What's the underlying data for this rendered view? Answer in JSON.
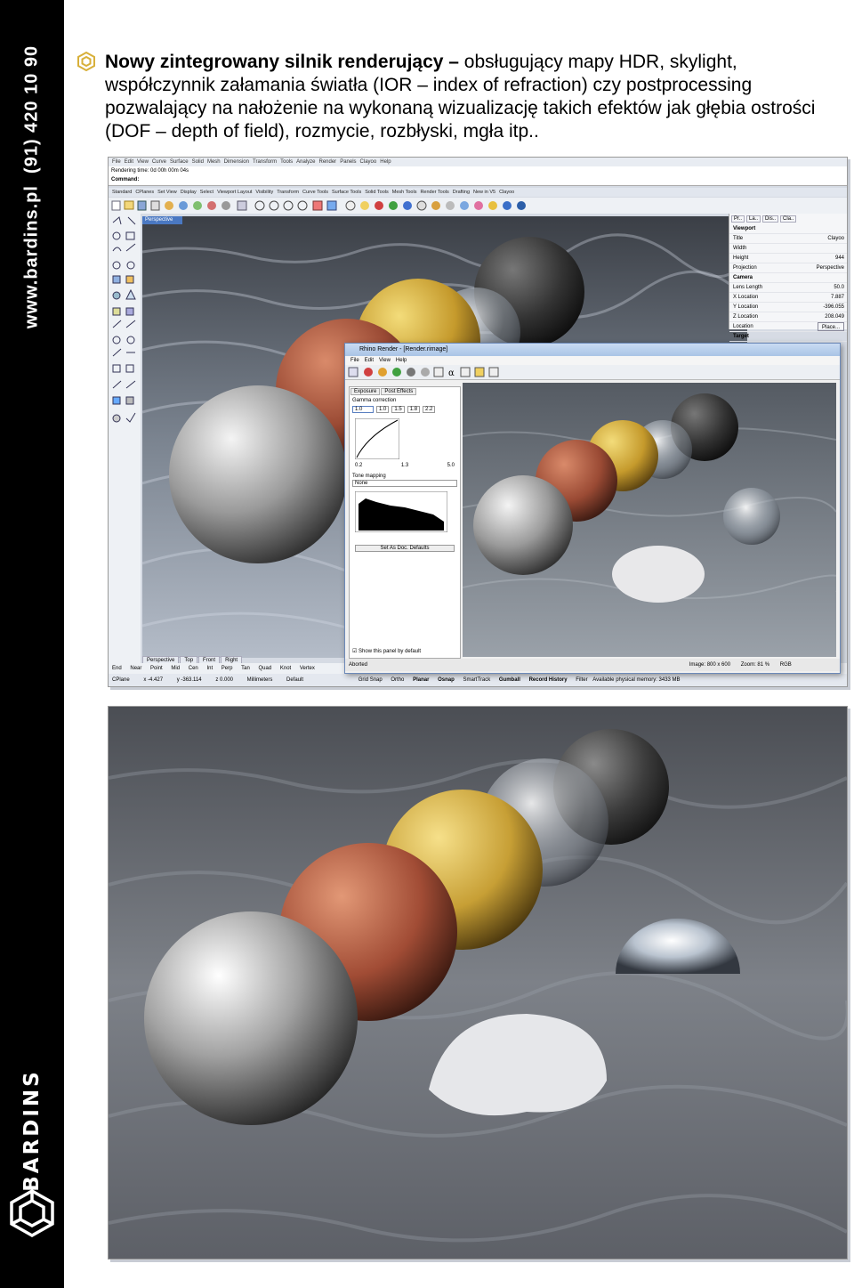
{
  "sidebar": {
    "url": "www.bardins.pl",
    "phone": "(91) 420 10 90",
    "brand": "BARDINS"
  },
  "headline": {
    "bold": "Nowy zintegrowany silnik renderujący –",
    "text": " obsługujący mapy HDR, skylight, współczynnik załamania światła (IOR – index of refraction) czy postprocessing pozwalający na nałożenie na wykonaną wizualizację takich efektów jak głębia ostrości (DOF – depth of field), rozmycie, rozbłyski, mgła itp.."
  },
  "rhino": {
    "menu": [
      "File",
      "Edit",
      "View",
      "Curve",
      "Surface",
      "Solid",
      "Mesh",
      "Dimension",
      "Transform",
      "Tools",
      "Analyze",
      "Render",
      "Panels",
      "Clayoo",
      "Help"
    ],
    "rendering_time": "Rendering time: 0d 00h 00m 04s",
    "command": "Command:",
    "tabs": [
      "Standard",
      "CPlanes",
      "Set View",
      "Display",
      "Select",
      "Viewport Layout",
      "Visibility",
      "Transform",
      "Curve Tools",
      "Surface Tools",
      "Solid Tools",
      "Mesh Tools",
      "Render Tools",
      "Drafting",
      "New in V5",
      "Clayoo"
    ],
    "viewport_title": "Perspective",
    "viewport_tabs": [
      "Perspective",
      "Top",
      "Front",
      "Right"
    ],
    "panel": {
      "tabs": [
        "Pr..",
        "La..",
        "Dis..",
        "Cla.."
      ],
      "section": "Viewport",
      "rows": [
        {
          "label": "Title",
          "value": "Clayoo"
        },
        {
          "label": "Width",
          "value": ""
        },
        {
          "label": "Height",
          "value": "944"
        },
        {
          "label": "Projection",
          "value": "Perspective"
        },
        {
          "label": "Camera",
          "value": ""
        },
        {
          "label": "Lens Length",
          "value": "50.0"
        },
        {
          "label": "X Location",
          "value": "7.887"
        },
        {
          "label": "Y Location",
          "value": "-396.055"
        },
        {
          "label": "Z Location",
          "value": "208.049"
        },
        {
          "label": "Location",
          "value": "Place..."
        },
        {
          "label": "Target",
          "value": ""
        }
      ]
    },
    "osnap": [
      "End",
      "Near",
      "Point",
      "Mid",
      "Cen",
      "Int",
      "Perp",
      "Tan",
      "Quad",
      "Knot",
      "Vertex"
    ],
    "status": {
      "cplane": "CPlane",
      "x": "x -4.427",
      "y": "y -363.114",
      "z": "z 0.000",
      "units": "Millimeters",
      "layer": "Default",
      "buttons": [
        "Grid Snap",
        "Ortho",
        "Planar",
        "Osnap",
        "SmartTrack",
        "Gumball",
        "Record History",
        "Filter"
      ],
      "memory": "Available physical memory: 3433 MB"
    }
  },
  "render_window": {
    "title": "Rhino Render - [Render.rimage]",
    "menu": [
      "File",
      "Edit",
      "View",
      "Help"
    ],
    "panel_tabs": [
      "Exposure",
      "Post Effects"
    ],
    "gamma_label": "Gamma correction",
    "gamma_value": "1.0",
    "gamma_presets": [
      "1.0",
      "1.5",
      "1.8",
      "2.2"
    ],
    "curve_ticks": [
      "0.2",
      "1.3",
      "5.0"
    ],
    "tone_label": "Tone mapping",
    "tone_value": "None",
    "defaults_button": "Set As Doc. Defaults",
    "show_checkbox": "Show this panel by default",
    "status_left": "Aborted",
    "image_size": "Image: 800 x 600",
    "zoom": "Zoom: 81 %",
    "mode": "RGB"
  },
  "colors": {
    "sidebar": "#000000",
    "rhino_blue": "#4a78c2",
    "window_frame": "#6c89b8"
  }
}
